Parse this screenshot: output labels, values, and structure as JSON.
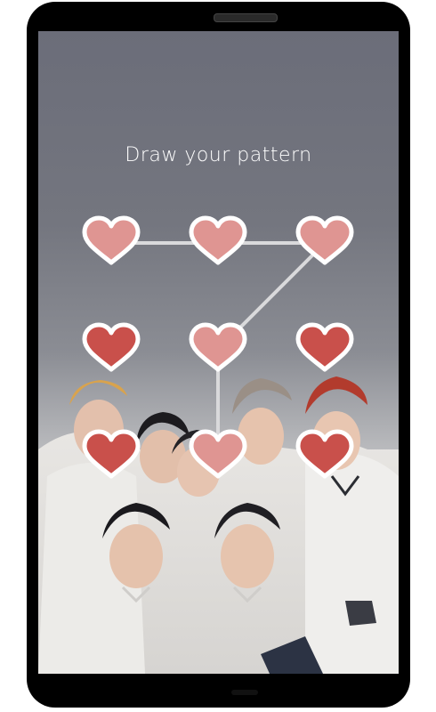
{
  "screen": {
    "prompt": "Draw your pattern"
  },
  "pattern": {
    "node_icon": "heart-icon",
    "colors": {
      "selected_fill": "#df9592",
      "unselected_fill": "#c9504b",
      "outline": "#ffffff",
      "line": "#d9d9db"
    },
    "nodes": [
      {
        "id": "1",
        "selected": true
      },
      {
        "id": "2",
        "selected": true
      },
      {
        "id": "3",
        "selected": true
      },
      {
        "id": "4",
        "selected": false
      },
      {
        "id": "5",
        "selected": true
      },
      {
        "id": "6",
        "selected": false
      },
      {
        "id": "7",
        "selected": false
      },
      {
        "id": "8",
        "selected": true
      },
      {
        "id": "9",
        "selected": false
      }
    ],
    "sequence": [
      "1",
      "2",
      "3",
      "5",
      "8"
    ]
  }
}
